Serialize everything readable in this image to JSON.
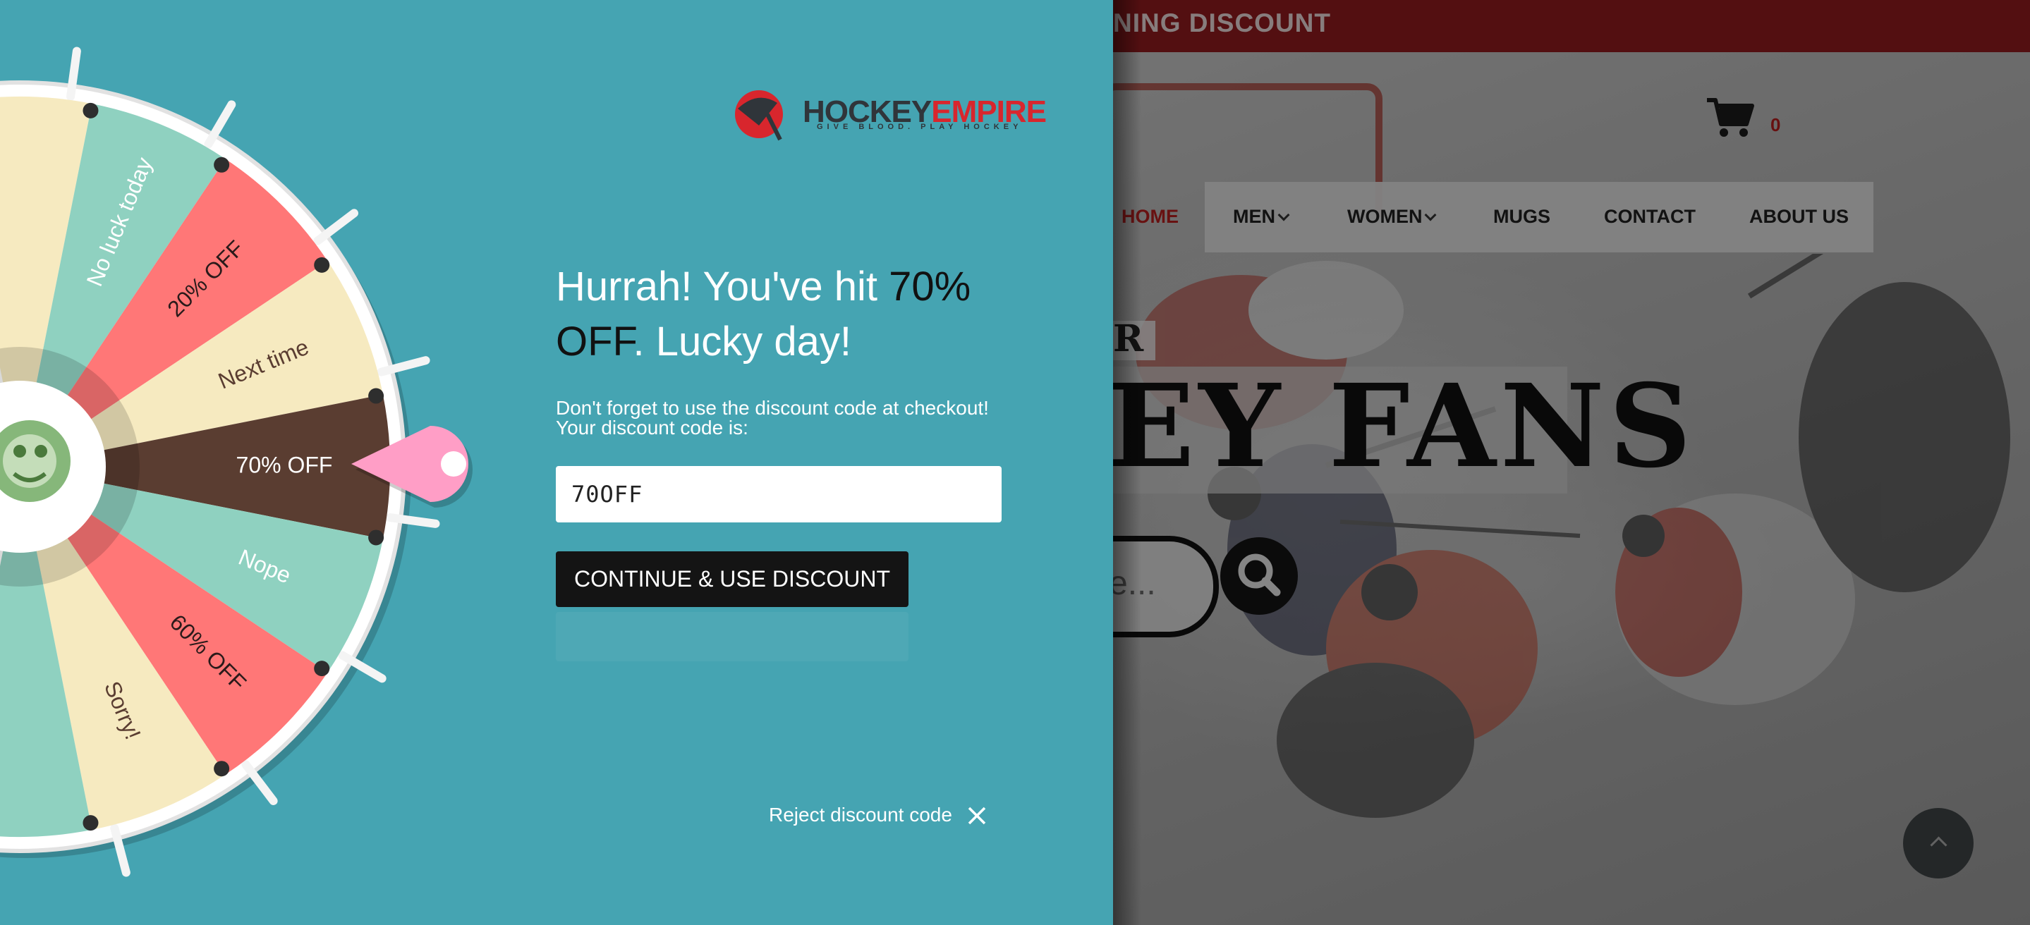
{
  "site": {
    "promo_text": "NING DISCOUNT",
    "cart_count": "0",
    "nav": {
      "home": "HOME",
      "items": [
        {
          "label": "MEN",
          "has_dropdown": true
        },
        {
          "label": "WOMEN",
          "has_dropdown": true
        },
        {
          "label": "MUGS",
          "has_dropdown": false
        },
        {
          "label": "CONTACT",
          "has_dropdown": false
        },
        {
          "label": "ABOUT US",
          "has_dropdown": false
        }
      ]
    },
    "hero_subtitle": "R",
    "hero_title": "EY FANS",
    "search_placeholder": "e...",
    "icons": [
      "cart-icon",
      "search-icon",
      "chevron-up-icon"
    ]
  },
  "popup": {
    "logo": {
      "hockey": "HOCKEY",
      "empire": "EMPIRE",
      "tagline": "GIVE BLOOD. PLAY HOCKEY"
    },
    "headline_before": "Hurrah! You've hit ",
    "headline_prize": "70% OFF",
    "headline_after": ". Lucky day!",
    "info_line1": "Don't forget to use the discount code at checkout!",
    "info_line2": "Your discount code is:",
    "discount_code": "70OFF",
    "continue_label": "CONTINUE & USE DISCOUNT",
    "reject_label": "Reject discount code",
    "wheel": {
      "segments": [
        {
          "label": "No luck today",
          "color": "#8fd1c0"
        },
        {
          "label": "20% OFF",
          "color": "#ff7777"
        },
        {
          "label": "Next time",
          "color": "#f6eac0"
        },
        {
          "label": "70% OFF",
          "color": "#5a3d31"
        },
        {
          "label": "Nope",
          "color": "#8fd1c0"
        },
        {
          "label": "60% OFF",
          "color": "#ff7777"
        },
        {
          "label": "Sorry!",
          "color": "#f6eac0"
        }
      ],
      "pointer_color": "#ff9ec6",
      "selected": "70% OFF"
    }
  },
  "colors": {
    "panel_bg": "#45a4b2",
    "promo_bar": "#8f1a1e",
    "brand_red": "#d8262d",
    "button_dark": "#141414"
  }
}
